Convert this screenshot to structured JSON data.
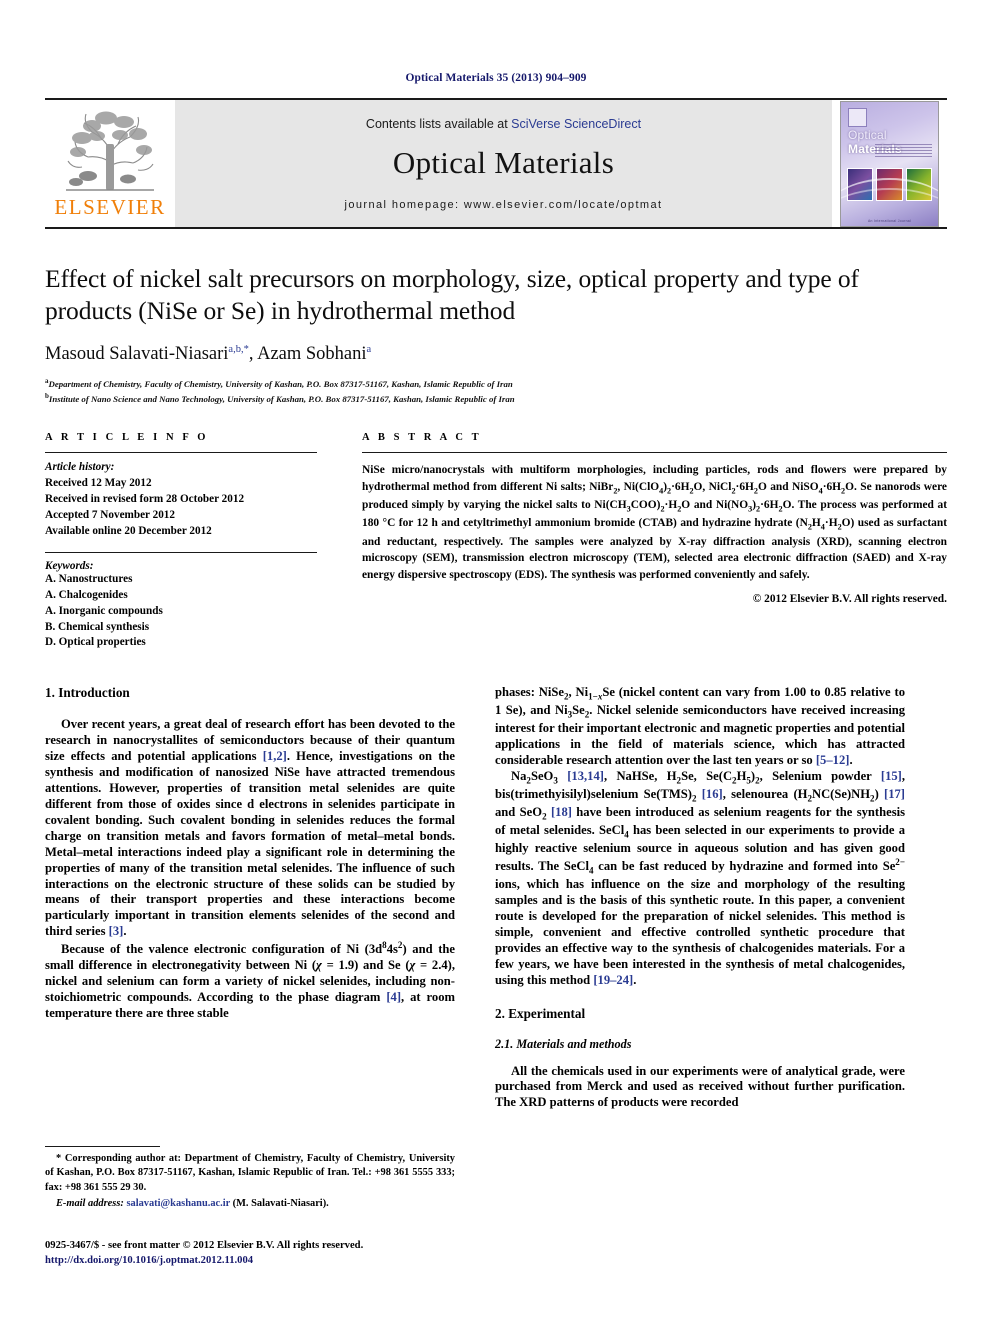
{
  "running_head": "Optical Materials 35 (2013) 904–909",
  "masthead": {
    "publisher_name": "ELSEVIER",
    "contents_prefix": "Contents lists available at ",
    "contents_link": "SciVerse ScienceDirect",
    "journal_name": "Optical Materials",
    "homepage_line": "journal homepage: www.elsevier.com/locate/optmat",
    "cover": {
      "title_part1": "Optical ",
      "title_part2": "Materials",
      "footer_text": "An International Journal"
    }
  },
  "article": {
    "title": "Effect of nickel salt precursors on morphology, size, optical property and type of products (NiSe or Se) in hydrothermal method",
    "authors": "Masoud Salavati-Niasari, Azam Sobhani",
    "author1": "Masoud Salavati-Niasari",
    "author1_sup": "a,b,*",
    "author2": "Azam Sobhani",
    "author2_sup": "a",
    "affiliation_a": "Department of Chemistry, Faculty of Chemistry, University of Kashan, P.O. Box 87317-51167, Kashan, Islamic Republic of Iran",
    "affiliation_b": "Institute of Nano Science and Nano Technology, University of Kashan, P.O. Box 87317-51167, Kashan, Islamic Republic of Iran"
  },
  "article_info": {
    "heading": "A R T I C L E   I N F O",
    "history_label": "Article history:",
    "history": [
      "Received 12 May 2012",
      "Received in revised form 28 October 2012",
      "Accepted 7 November 2012",
      "Available online 20 December 2012"
    ],
    "keywords_label": "Keywords:",
    "keywords": [
      "A. Nanostructures",
      "A. Chalcogenides",
      "A. Inorganic compounds",
      "B. Chemical synthesis",
      "D. Optical properties"
    ]
  },
  "abstract": {
    "heading": "A B S T R A C T",
    "copyright": "© 2012 Elsevier B.V. All rights reserved."
  },
  "sections": {
    "intro_heading": "1. Introduction",
    "experimental_heading": "2. Experimental",
    "materials_heading": "2.1. Materials and methods"
  },
  "footnote": {
    "corresponding": "* Corresponding author at: Department of Chemistry, Faculty of Chemistry, University of Kashan, P.O. Box 87317-51167, Kashan, Islamic Republic of Iran. Tel.: +98 361 5555 333; fax: +98 361 555 29 30.",
    "email_label": "E-mail address:",
    "email": "salavati@kashanu.ac.ir",
    "email_owner": "(M. Salavati-Niasari)."
  },
  "colophon": {
    "issn_line": "0925-3467/$ - see front matter © 2012 Elsevier B.V. All rights reserved.",
    "doi": "http://dx.doi.org/10.1016/j.optmat.2012.11.004"
  },
  "colors": {
    "link_blue": "#2a3b92",
    "elsevier_orange": "#f07f09",
    "running_head_navy": "#15186b"
  }
}
